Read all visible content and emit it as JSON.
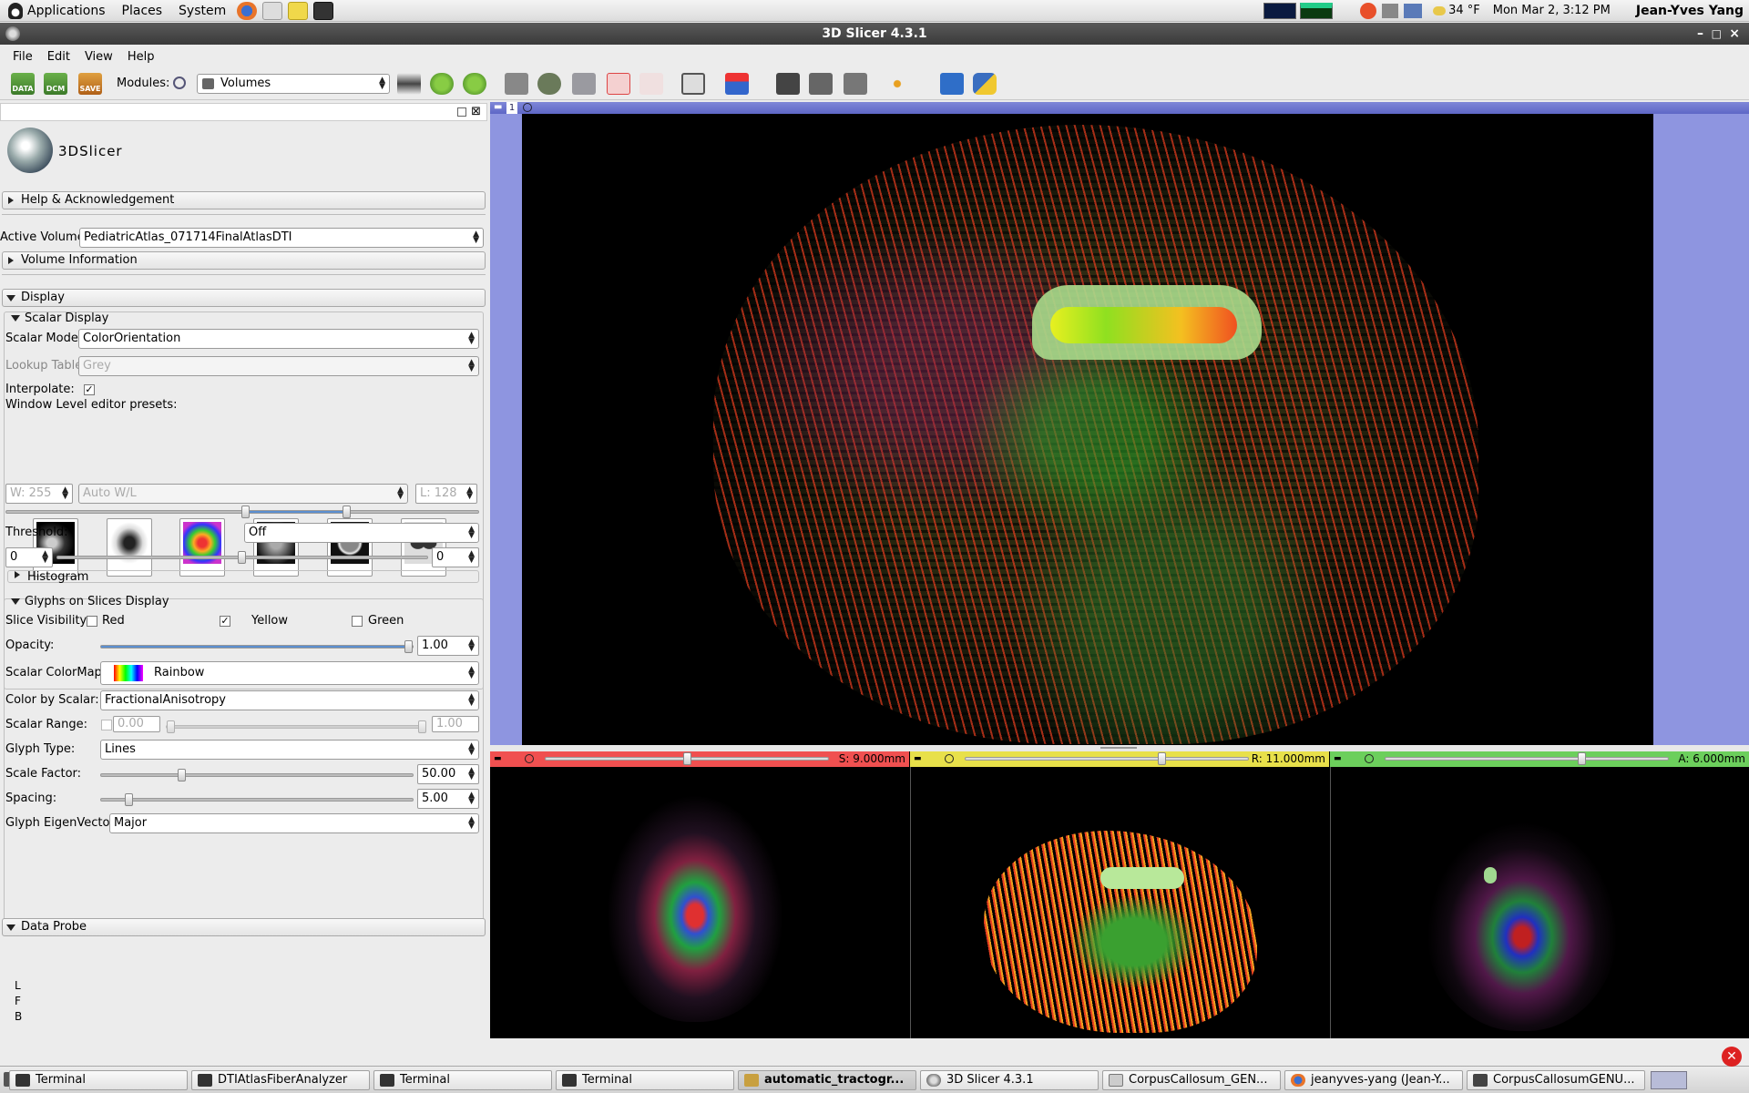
{
  "topbar": {
    "menus": [
      "Applications",
      "Places",
      "System"
    ],
    "weather": "34 °F",
    "clock": "Mon Mar  2,  3:12 PM",
    "user": "Jean-Yves Yang"
  },
  "window": {
    "title": "3D Slicer 4.3.1"
  },
  "menubar": {
    "items": [
      "File",
      "Edit",
      "View",
      "Help"
    ]
  },
  "toolbar": {
    "modules_label": "Modules:",
    "module_value": "Volumes",
    "data_label": "DATA",
    "dcm_label": "DCM",
    "save_label": "SAVE"
  },
  "left": {
    "logo_text": "3DSlicer",
    "help_section": "Help & Acknowledgement",
    "active_volume_label": "Active Volume",
    "active_volume_value": "PediatricAtlas_071714FinalAtlasDTI",
    "volume_info_section": "Volume Information",
    "display_section": "Display",
    "scalar_display": "Scalar Display",
    "scalar_mode_label": "Scalar Mode:",
    "scalar_mode_value": "ColorOrientation",
    "lookup_table_label": "Lookup Table:",
    "lookup_table_value": "Grey",
    "interpolate_label": "Interpolate:",
    "interpolate_check": "✓",
    "presets_label": "Window Level editor presets:",
    "window_value": "W: 255",
    "wl_mode": "Auto W/L",
    "level_value": "L: 128",
    "threshold_label": "Threshold:",
    "threshold_value": "Off",
    "threshold_min": "0",
    "threshold_max": "0",
    "histogram": "Histogram",
    "glyphs_section": "Glyphs on Slices Display",
    "slice_visibility_label": "Slice Visibility:",
    "vis_red": "Red",
    "vis_yellow": "Yellow",
    "vis_green": "Green",
    "yellow_check": "✓",
    "opacity_label": "Opacity:",
    "opacity_value": "1.00",
    "opacity_level": 1.0,
    "colormap_label": "Scalar ColorMap:",
    "colormap_value": "Rainbow",
    "color_by_label": "Color by Scalar:",
    "color_by_value": "FractionalAnisotropy",
    "scalar_range_label": "Scalar Range:",
    "range_min": "0.00",
    "range_max": "1.00",
    "glyph_type_label": "Glyph Type:",
    "glyph_type_value": "Lines",
    "scale_factor_label": "Scale Factor:",
    "scale_factor_value": "50.00",
    "spacing_label": "Spacing:",
    "spacing_value": "5.00",
    "eigenvector_label": "Glyph EigenVector:",
    "eigenvector_value": "Major",
    "data_probe_section": "Data Probe",
    "probe_lines": [
      "L",
      "F",
      "B"
    ]
  },
  "views": {
    "layout_number": "1",
    "red_offset": "S: 9.000mm",
    "yellow_offset": "R: 11.000mm",
    "green_offset": "A: 6.000mm",
    "colors": {
      "red": "#f05050",
      "yellow": "#e8e04a",
      "green": "#6ccf5c",
      "view_bg": "#8e95e0"
    }
  },
  "taskbar": {
    "items": [
      {
        "label": "Terminal",
        "active": false
      },
      {
        "label": "DTIAtlasFiberAnalyzer",
        "active": false
      },
      {
        "label": "Terminal",
        "active": false
      },
      {
        "label": "Terminal",
        "active": false
      },
      {
        "label": "automatic_tractogr...",
        "active": true
      },
      {
        "label": "3D Slicer 4.3.1",
        "active": false
      },
      {
        "label": "CorpusCallosum_GEN...",
        "active": false
      },
      {
        "label": "jeanyves-yang (Jean-Y...",
        "active": false
      },
      {
        "label": "CorpusCallosumGENU...",
        "active": false
      }
    ]
  }
}
